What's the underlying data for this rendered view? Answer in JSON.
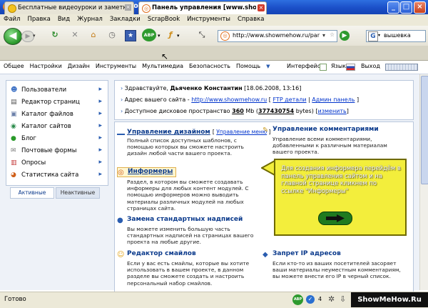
{
  "window": {
    "title": "Панель управления [www.showmehow.ru] - Mozilla Firefox"
  },
  "menubar": [
    "Файл",
    "Правка",
    "Вид",
    "Журнал",
    "Закладки",
    "ScrapBook",
    "Инструменты",
    "Справка"
  ],
  "navbar": {
    "url": "http://www.showmehow.ru/pan",
    "search_value": "вышевка",
    "abp_label": "ABP"
  },
  "tabs": [
    {
      "label": "Бесплатные видеоуроки и заметки - ...",
      "active": false
    },
    {
      "label": "Панель управления [www.showm...",
      "active": true
    }
  ],
  "site_menu": {
    "items": [
      "Общее",
      "Настройки",
      "Дизайн",
      "Инструменты",
      "Мультимедиа",
      "Безопасность",
      "Помощь"
    ],
    "right": [
      "Интерфейс",
      "Язык",
      "Выход"
    ]
  },
  "sidebar": {
    "items": [
      {
        "label": "Пользователи",
        "icon": "users-icon"
      },
      {
        "label": "Редактор страниц",
        "icon": "page-editor-icon"
      },
      {
        "label": "Каталог файлов",
        "icon": "file-catalog-icon"
      },
      {
        "label": "Каталог сайтов",
        "icon": "site-catalog-icon"
      },
      {
        "label": "Блог",
        "icon": "blog-icon"
      },
      {
        "label": "Почтовые формы",
        "icon": "mail-forms-icon"
      },
      {
        "label": "Опросы",
        "icon": "polls-icon"
      },
      {
        "label": "Статистика сайта",
        "icon": "statistics-icon"
      }
    ],
    "tabs": [
      "Активные",
      "Неактивные"
    ]
  },
  "info": {
    "greeting_prefix": "Здравствуйте,",
    "user_name": "Дьяченко Константин",
    "datetime": "[18.06.2008, 13:16]",
    "address_label": "Адрес вашего сайта -",
    "site_url": "http://www.showmehow.ru",
    "ftp_link": "FTP детали",
    "admin_link": "Админ панель",
    "space_label": "Доступное дисковое пространство",
    "space_mb": "360",
    "space_unit": "Mb",
    "space_bytes": "377430754",
    "space_bytes_unit": "bytes",
    "change_link": "изменить"
  },
  "sections": {
    "design": {
      "title": "Управление дизайном",
      "menu_link": "Управление меню",
      "desc": "Полный список доступных шаблонов, с помощью которых вы сможете настроить дизайн любой части вашего проекта."
    },
    "comments": {
      "title": "Управление комментариями",
      "desc": "Управление всеми комментариями, добавленными к различным материалам вашего проекта."
    },
    "informers": {
      "title": "Информеры",
      "desc": "Раздел, в котором вы сможете создавать информеры для любых контент модулей. С помощью информеров можно выводить материалы различных модулей на любых страницах сайта."
    },
    "captions": {
      "title": "Замена стандартных надписей",
      "desc": "Вы можете изменить большую часть стандартных надписей на страницах вашего проекта на любые другие."
    },
    "smiles": {
      "title": "Редактор смайлов",
      "desc": "Если у вас есть смайлы, которые вы хотите использовать в вашем проекте, в данном разделе вы сможете создать и настроить персональный набор смайлов."
    },
    "ipban": {
      "title": "Запрет IP адресов",
      "desc": "Если кто-то из ваших посетителей засоряет ваши материалы неуместным комментариям, вы можете внести его IP в черный список."
    }
  },
  "callout": {
    "text": "Для создания информера перейдём в панель управления сайтом и на главной странице кликнем по ссылке \"Информеры\""
  },
  "status": {
    "text": "Готово",
    "count": "4",
    "brand": "ShowMeHow.Ru"
  },
  "colors": {
    "titlebar": "#1b4fc8",
    "section_title": "#0b3a8c",
    "callout_bg": "#f3ee3c"
  }
}
